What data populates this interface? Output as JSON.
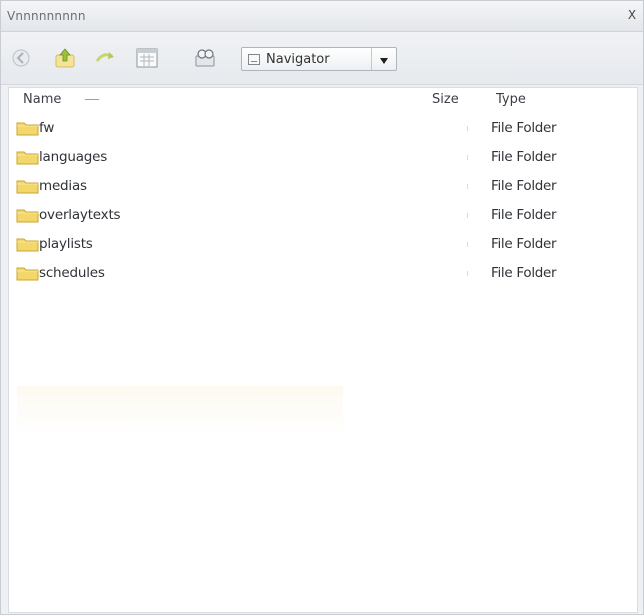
{
  "window": {
    "title": "Vnnnnnnnnn",
    "close_glyph": "X"
  },
  "toolbar": {
    "buttons": [
      {
        "name": "back-icon"
      },
      {
        "name": "up-folder-icon"
      },
      {
        "name": "forward-icon"
      },
      {
        "name": "view-calendar-icon"
      },
      {
        "name": "search-icon"
      }
    ],
    "location_value": "Navigator",
    "dropdown_icon": "chevron-down-icon"
  },
  "list": {
    "columns": {
      "name": "Name",
      "size": "Size",
      "type": "Type"
    },
    "rows": [
      {
        "name": "fw",
        "type": "File Folder"
      },
      {
        "name": "languages",
        "type": "File Folder"
      },
      {
        "name": "medias",
        "type": "File Folder"
      },
      {
        "name": "overlaytexts",
        "type": "File Folder"
      },
      {
        "name": "playlists",
        "type": "File Folder"
      },
      {
        "name": "schedules",
        "type": "File Folder"
      }
    ]
  },
  "colors": {
    "folder_fill": "#f3d76a",
    "folder_edge": "#c9a52d",
    "accent_green": "#a9c94b"
  }
}
